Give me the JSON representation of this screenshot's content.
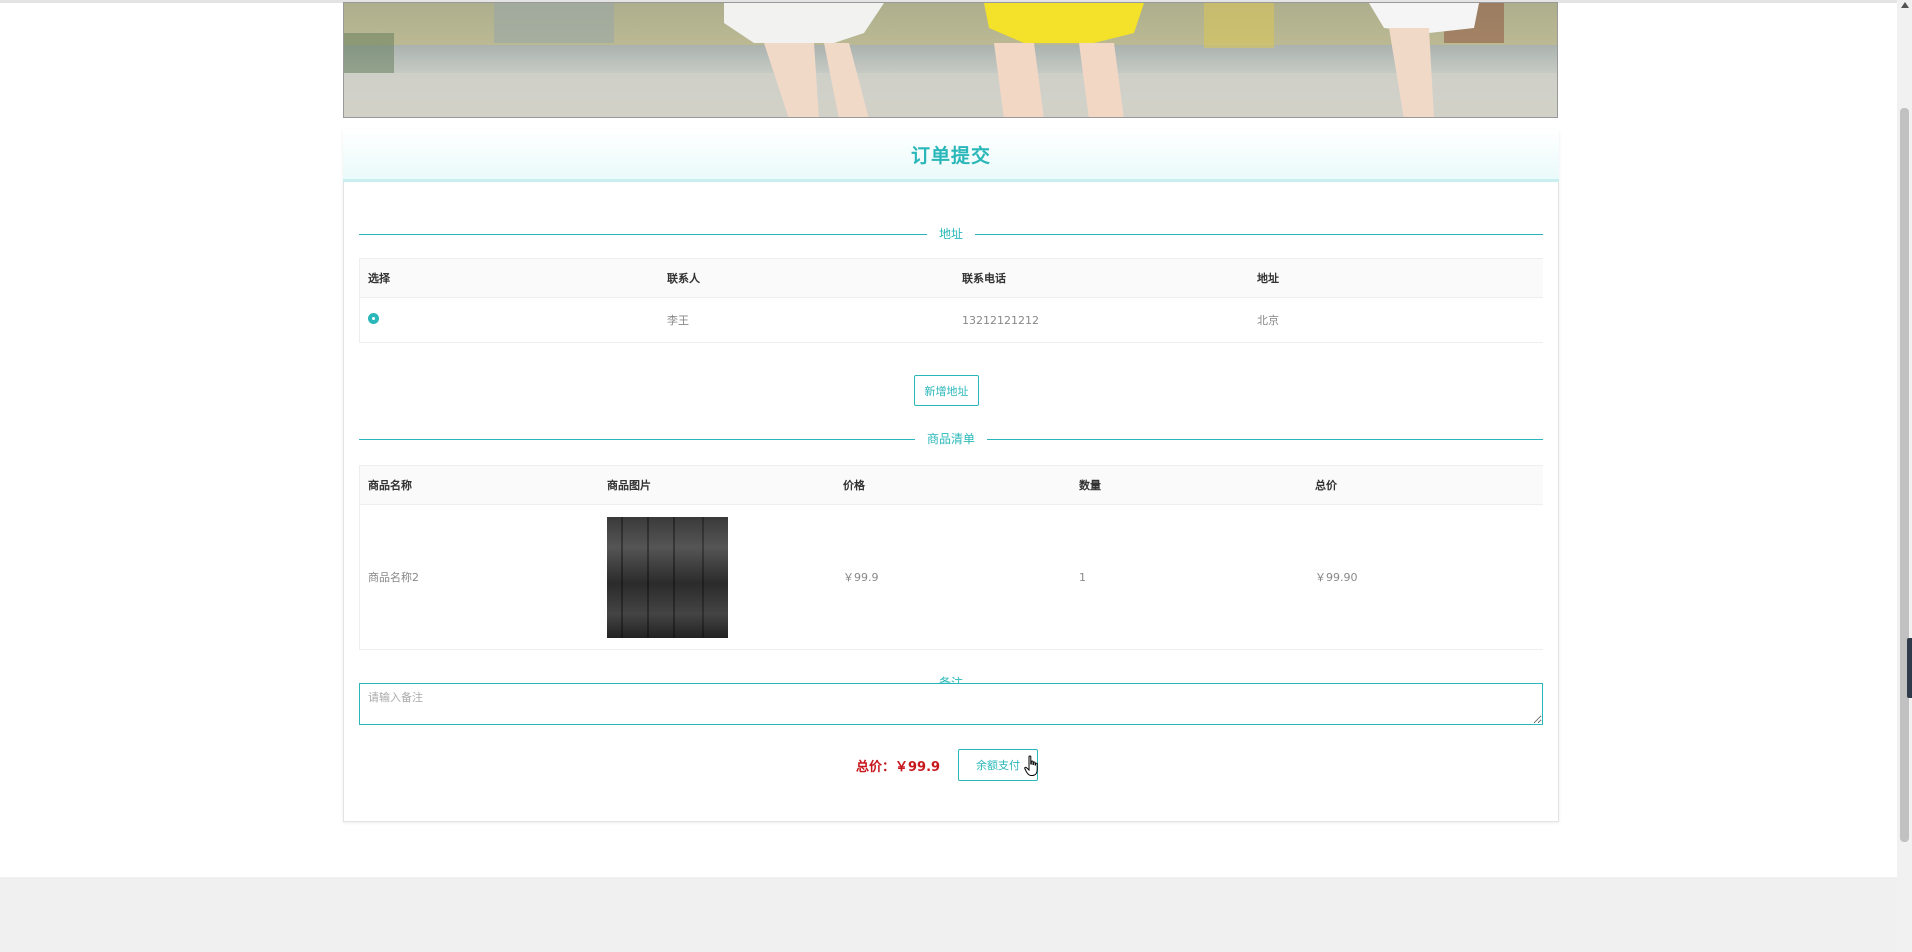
{
  "page": {
    "title": "订单提交"
  },
  "address_section": {
    "label": "地址",
    "columns": [
      "选择",
      "联系人",
      "联系电话",
      "地址"
    ],
    "rows": [
      {
        "selected": true,
        "contact": "李王",
        "phone": "13212121212",
        "address": "北京"
      }
    ],
    "add_button": "新增地址"
  },
  "goods_section": {
    "label": "商品清单",
    "columns": [
      "商品名称",
      "商品图片",
      "价格",
      "数量",
      "总价"
    ],
    "rows": [
      {
        "name": "商品名称2",
        "image_icon": "product-photo-computers",
        "price": "￥99.9",
        "quantity": "1",
        "total": "￥99.90"
      }
    ]
  },
  "remark_section": {
    "label": "备注",
    "placeholder": "请输入备注",
    "value": ""
  },
  "summary": {
    "total_label": "总价：￥99.9",
    "pay_button": "余额支付"
  },
  "colors": {
    "accent": "#2ab7b9",
    "price": "#c8161d",
    "footer_band": "#f0f0f0"
  }
}
